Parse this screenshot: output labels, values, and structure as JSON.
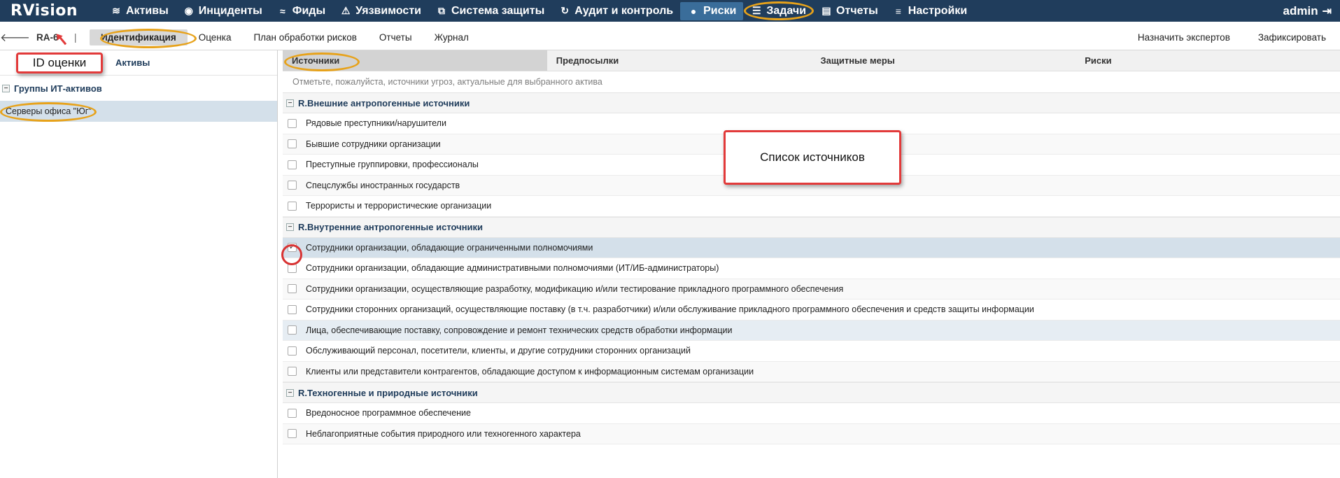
{
  "topnav": {
    "logo": "RVision",
    "items": [
      {
        "label": "Активы",
        "icon": "database-icon",
        "glyph": "≋"
      },
      {
        "label": "Инциденты",
        "icon": "target-icon",
        "glyph": "◉"
      },
      {
        "label": "Фиды",
        "icon": "rss-icon",
        "glyph": "≈"
      },
      {
        "label": "Уязвимости",
        "icon": "warning-icon",
        "glyph": "⚠"
      },
      {
        "label": "Система защиты",
        "icon": "windows-icon",
        "glyph": "⧉"
      },
      {
        "label": "Аудит и контроль",
        "icon": "refresh-icon",
        "glyph": "↻"
      },
      {
        "label": "Риски",
        "icon": "risk-icon",
        "glyph": "●"
      },
      {
        "label": "Задачи",
        "icon": "tasks-icon",
        "glyph": "☰"
      },
      {
        "label": "Отчеты",
        "icon": "report-icon",
        "glyph": "▤"
      },
      {
        "label": "Настройки",
        "icon": "menu-icon",
        "glyph": "≡"
      }
    ],
    "user": "admin"
  },
  "subbar": {
    "id": "RA-6",
    "separator": "|",
    "tabs": [
      "Идентификация",
      "Оценка",
      "План обработки рисков",
      "Отчеты",
      "Журнал"
    ],
    "actions": [
      "Назначить экспертов",
      "Зафиксировать"
    ]
  },
  "left": {
    "tabs": [
      "ID оценки",
      "Активы"
    ],
    "group": "Группы ИТ-активов",
    "asset": "Серверы офиса \"Юг\""
  },
  "main": {
    "tabs": [
      "Источники",
      "Предпосылки",
      "Защитные меры",
      "Риски"
    ],
    "hint": "Отметьте, пожалуйста, источники угроз, актуальные для выбранного актива",
    "sections": [
      {
        "title": "R.Внешние антропогенные источники",
        "items": [
          "Рядовые преступники/нарушители",
          "Бывшие сотрудники организации",
          "Преступные группировки, профессионалы",
          "Спецслужбы иностранных государств",
          "Террористы и террористические организации"
        ]
      },
      {
        "title": "R.Внутренние антропогенные источники",
        "items": [
          "Сотрудники организации, обладающие ограниченными полномочиями",
          "Сотрудники организации, обладающие административными полномочиями (ИТ/ИБ-администраторы)",
          "Сотрудники организации, осуществляющие разработку, модификацию и/или тестирование прикладного программного обеспечения",
          "Сотрудники сторонних организаций, осуществляющие поставку (в т.ч. разработчики) и/или обслуживание прикладного программного обеспечения и средств защиты информации",
          "Лица, обеспечивающие поставку, сопровождение и ремонт технических средств обработки информации",
          "Обслуживающий персонал, посетители, клиенты, и другие сотрудники сторонних организаций",
          "Клиенты или представители контрагентов, обладающие доступом к информационным системам организации"
        ]
      },
      {
        "title": "R.Техногенные и природные источники",
        "items": [
          "Вредоносное программное обеспечение",
          "Неблагоприятные события природного или техногенного характера"
        ]
      }
    ]
  },
  "annotations": {
    "sources_callout": "Список источников",
    "id_callout": "ID оценки"
  }
}
